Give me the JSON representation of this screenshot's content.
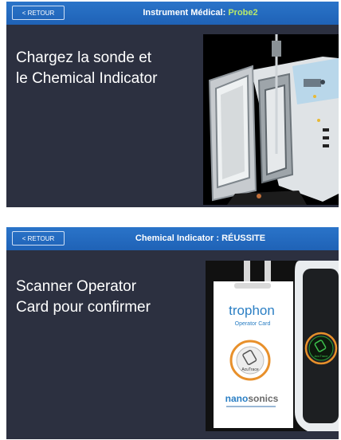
{
  "screen1": {
    "back_label": "< RETOUR",
    "title_prefix": "Instrument Médical: ",
    "title_accent": "Probe2",
    "message_line1": "Chargez la sonde et",
    "message_line2": "le Chemical Indicator",
    "image_icon": "trophon-open-chamber-photo"
  },
  "screen2": {
    "back_label": "< RETOUR",
    "title": "Chemical Indicator : RÉUSSITE",
    "message_line1": "Scanner Operator",
    "message_line2": "Card pour confirmer",
    "card": {
      "brand": "trophon",
      "subtitle": "Operator Card",
      "tag": "AcuTrace",
      "company_prefix": "nano",
      "company_suffix": "sonics"
    },
    "reader_tag": "AcuTrace"
  },
  "colors": {
    "topbar": "#2370c5",
    "panel": "#2c3040",
    "accent": "#b8e86b",
    "card_blue": "#2b7fc4",
    "ring_orange": "#e8902b"
  }
}
